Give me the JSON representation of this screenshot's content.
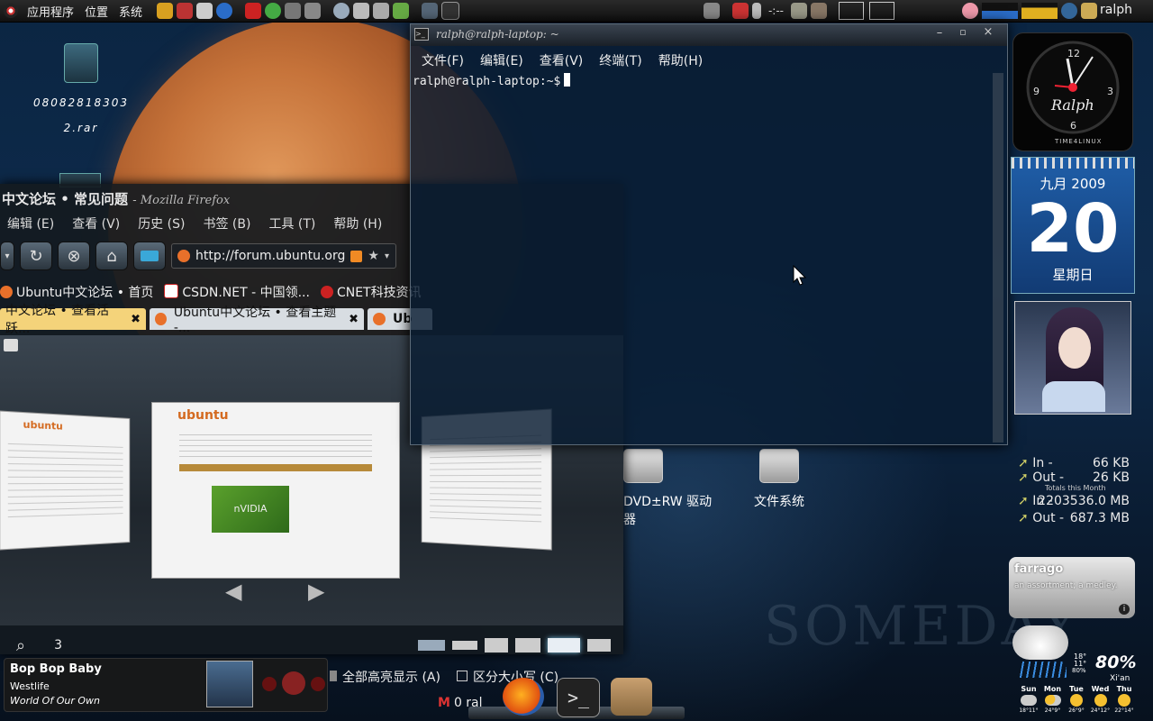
{
  "panel": {
    "menus": [
      "应用程序",
      "位置",
      "系统"
    ],
    "clock_text": "-:--",
    "user": "ralph"
  },
  "desktop": {
    "icons": [
      {
        "label": "08082818303 2.rar"
      },
      {
        "label": "DVD±RW 驱动器"
      },
      {
        "label": "文件系统"
      }
    ],
    "wallpaper_text": "SOMEDAY"
  },
  "firefox": {
    "title": "中文论坛 • 常见问题",
    "title_suffix": "- Mozilla Firefox",
    "menus": [
      "编辑 (E)",
      "查看 (V)",
      "历史 (S)",
      "书签 (B)",
      "工具 (T)",
      "帮助 (H)"
    ],
    "url": "http://forum.ubuntu.org",
    "bookmarks": [
      "Ubuntu中文论坛 • 首页",
      "CSDN.NET - 中国领...",
      "CNET科技资讯"
    ],
    "tabs": [
      {
        "label": "中文论坛 • 查看活跃...",
        "active": false
      },
      {
        "label": "Ubuntu中文论坛 • 查看主题 -...",
        "active": true
      },
      {
        "label": "Ub",
        "active": false
      }
    ],
    "page_count": "3",
    "find_highlight_all": "全部高亮显示 (A)",
    "find_match_case": "区分大小写 (C)",
    "status_mail": "0 ral",
    "thumb_nvidia_text": "nVIDIA",
    "thumb_brand": "ubuntu"
  },
  "terminal": {
    "title": "ralph@ralph-laptop: ~",
    "menus": [
      "文件(F)",
      "编辑(E)",
      "查看(V)",
      "终端(T)",
      "帮助(H)"
    ],
    "prompt": "ralph@ralph-laptop:~$"
  },
  "clock_widget": {
    "name": "Ralph",
    "numerals": [
      "12",
      "3",
      "6",
      "9"
    ],
    "brand": "TIME4LINUX"
  },
  "calendar": {
    "month_year": "九月 2009",
    "day": "20",
    "weekday": "星期日"
  },
  "network": {
    "in_label": "In -",
    "in_value": "66 KB",
    "out_label": "Out -",
    "out_value": "26 KB",
    "totals_label": "Totals this Month",
    "month_in_label": "In -",
    "month_in_value": "2203536.0 MB",
    "month_out_label": "Out -",
    "month_out_value": "687.3 MB"
  },
  "farrago": {
    "word": "farrago",
    "definition": "an assortment; a medley."
  },
  "weather": {
    "humidity": "80%",
    "location": "Xi'an",
    "temps": [
      "18°",
      "11°",
      "80%"
    ],
    "days": [
      {
        "day": "Sun",
        "temp": "18°11°"
      },
      {
        "day": "Mon",
        "temp": "24°9°"
      },
      {
        "day": "Tue",
        "temp": "26°9°"
      },
      {
        "day": "Wed",
        "temp": "24°12°"
      },
      {
        "day": "Thu",
        "temp": "22°14°"
      }
    ]
  },
  "music": {
    "title": "Bop Bop Baby",
    "artist": "Westlife",
    "album": "World Of Our Own"
  },
  "colors": {
    "ff_tab_inactive": "#f4d37a",
    "ff_tab_active": "#d8dde2",
    "calendar_blue": "#1f5ea8"
  }
}
